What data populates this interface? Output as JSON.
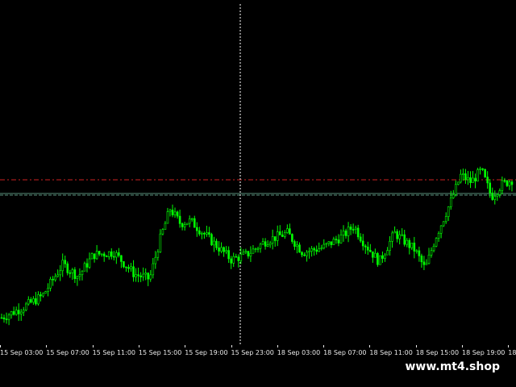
{
  "watermark": "www.mt4.shop",
  "colors": {
    "background": "#000000",
    "candle": "#00ff00",
    "ask_line": "#cc2222",
    "bid_line": "#5a8f7b",
    "crosshair": "#ffffff"
  },
  "chart_data": {
    "type": "candlestick",
    "x_labels": [
      "15 Sep 03:00",
      "15 Sep 07:00",
      "15 Sep 11:00",
      "15 Sep 15:00",
      "15 Sep 19:00",
      "15 Sep 23:00",
      "18 Sep 03:00",
      "18 Sep 07:00",
      "18 Sep 11:00",
      "18 Sep 15:00",
      "18 Sep 19:00",
      "18"
    ],
    "price_levels": {
      "ask": 0.71,
      "bid": 0.65
    },
    "ylim": [
      0,
      1
    ],
    "crosshair_time": "15 Sep 23:00",
    "series": [
      {
        "t": 0,
        "v": 0.12
      },
      {
        "t": 0.04,
        "v": 0.16
      },
      {
        "t": 0.08,
        "v": 0.21
      },
      {
        "t": 0.12,
        "v": 0.34
      },
      {
        "t": 0.15,
        "v": 0.29
      },
      {
        "t": 0.18,
        "v": 0.38
      },
      {
        "t": 0.22,
        "v": 0.39
      },
      {
        "t": 0.26,
        "v": 0.3
      },
      {
        "t": 0.29,
        "v": 0.28
      },
      {
        "t": 0.31,
        "v": 0.44
      },
      {
        "t": 0.33,
        "v": 0.57
      },
      {
        "t": 0.35,
        "v": 0.51
      },
      {
        "t": 0.37,
        "v": 0.52
      },
      {
        "t": 0.39,
        "v": 0.48
      },
      {
        "t": 0.42,
        "v": 0.42
      },
      {
        "t": 0.45,
        "v": 0.36
      },
      {
        "t": 0.48,
        "v": 0.38
      },
      {
        "t": 0.52,
        "v": 0.44
      },
      {
        "t": 0.56,
        "v": 0.47
      },
      {
        "t": 0.59,
        "v": 0.39
      },
      {
        "t": 0.63,
        "v": 0.41
      },
      {
        "t": 0.67,
        "v": 0.46
      },
      {
        "t": 0.69,
        "v": 0.5
      },
      {
        "t": 0.71,
        "v": 0.43
      },
      {
        "t": 0.74,
        "v": 0.35
      },
      {
        "t": 0.77,
        "v": 0.47
      },
      {
        "t": 0.81,
        "v": 0.4
      },
      {
        "t": 0.83,
        "v": 0.32
      },
      {
        "t": 0.85,
        "v": 0.45
      },
      {
        "t": 0.88,
        "v": 0.6
      },
      {
        "t": 0.9,
        "v": 0.71
      },
      {
        "t": 0.92,
        "v": 0.68
      },
      {
        "t": 0.94,
        "v": 0.73
      },
      {
        "t": 0.96,
        "v": 0.62
      },
      {
        "t": 0.98,
        "v": 0.67
      },
      {
        "t": 1.0,
        "v": 0.69
      }
    ]
  }
}
